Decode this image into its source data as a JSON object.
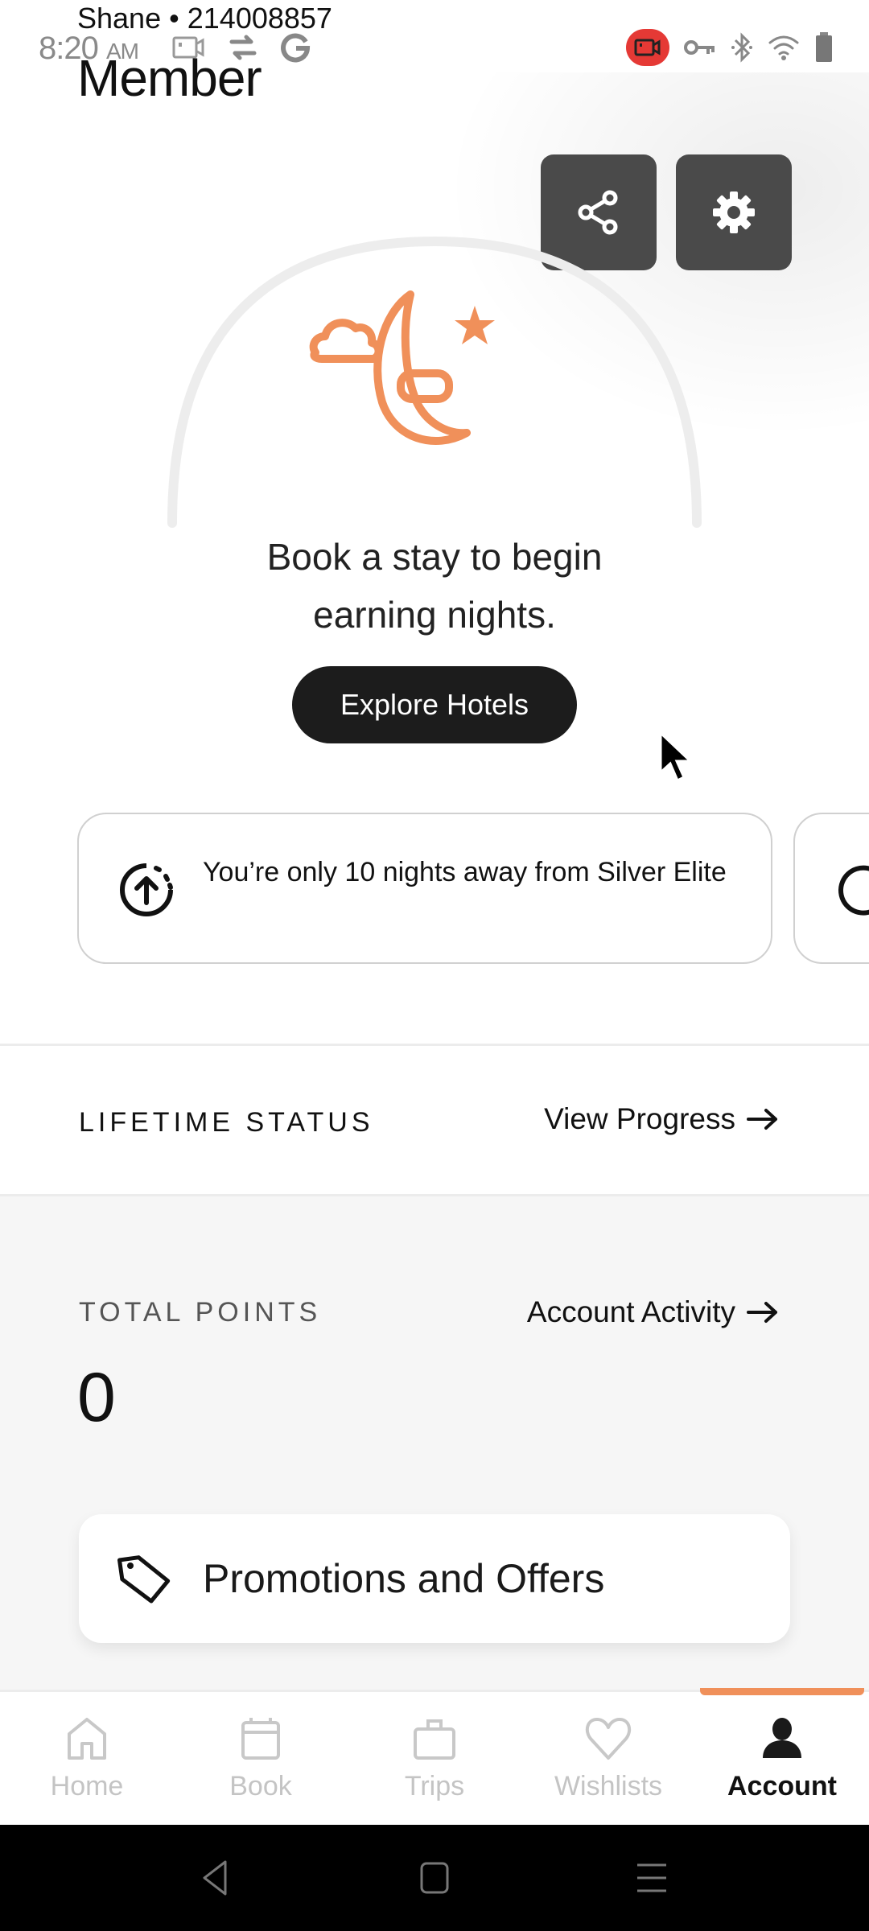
{
  "status_bar": {
    "time": "8:20",
    "ampm": "AM",
    "left_icons": [
      "screen-record-icon",
      "sync-icon",
      "google-icon"
    ],
    "right_icons": [
      "recording-icon",
      "vpn-key-icon",
      "bluetooth-icon",
      "wifi-icon",
      "battery-icon"
    ],
    "recording_color": "#e53935"
  },
  "header": {
    "member_name": "Shane",
    "separator": "•",
    "member_number": "214008857",
    "tier": "Member"
  },
  "actions": {
    "share_icon": "share-icon",
    "settings_icon": "gear-icon"
  },
  "hero": {
    "icon": "moon-cloud-star-icon",
    "accent_color": "#f0905a",
    "message": "Book a stay to begin earning nights.",
    "cta_label": "Explore Hotels"
  },
  "progress_cards": [
    {
      "icon": "circle-arrow-up-icon",
      "text": "You’re only 10 nights away from Silver Elite"
    },
    {
      "icon": "refresh-icon",
      "text": ""
    }
  ],
  "lifetime": {
    "label": "LIFETIME STATUS",
    "link_label": "View Progress",
    "link_icon": "arrow-right-icon"
  },
  "points": {
    "label": "TOTAL POINTS",
    "value": "0",
    "link_label": "Account Activity",
    "link_icon": "arrow-right-icon"
  },
  "promotions": {
    "icon": "tag-icon",
    "label": "Promotions and Offers"
  },
  "bottom_nav": {
    "active_index": 4,
    "indicator_color": "#f0905a",
    "items": [
      {
        "label": "Home",
        "icon": "home-icon"
      },
      {
        "label": "Book",
        "icon": "calendar-icon"
      },
      {
        "label": "Trips",
        "icon": "suitcase-icon"
      },
      {
        "label": "Wishlists",
        "icon": "heart-icon"
      },
      {
        "label": "Account",
        "icon": "person-icon"
      }
    ]
  },
  "system_nav": [
    "back-icon",
    "home-square-icon",
    "recents-icon"
  ]
}
